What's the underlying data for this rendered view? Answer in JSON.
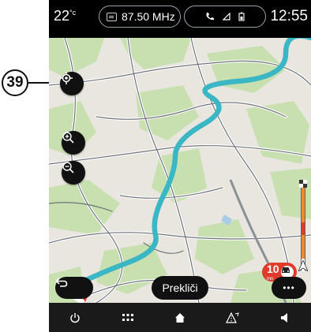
{
  "callout": {
    "number": "39"
  },
  "status": {
    "temperature": "22",
    "temperature_unit": "°c",
    "radio_frequency": "87.50 MHz",
    "clock": "12:55"
  },
  "map": {
    "route_color": "#3bb6c4",
    "park_color": "#c8e0b0",
    "road_color": "#ffffff"
  },
  "speed_limit": {
    "value": "10",
    "unit": "mn"
  },
  "actions": {
    "cancel_label": "Prekliči",
    "more_label": "•••"
  },
  "icons": {
    "locate": "crosshair-icon",
    "zoom_in": "zoom-in-icon",
    "zoom_out": "zoom-out-icon",
    "back": "return-arrow-icon",
    "power": "power-icon",
    "apps": "grid-icon",
    "home": "home-icon",
    "nav": "navigation-icon",
    "volume": "volume-icon"
  }
}
